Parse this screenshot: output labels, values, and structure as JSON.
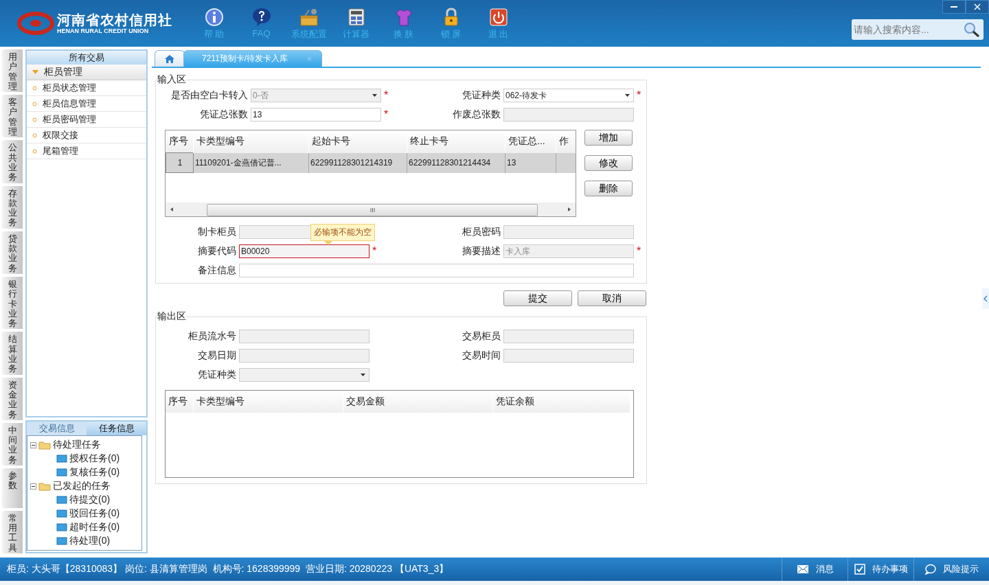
{
  "header": {
    "logo_title": "河南省农村信用社",
    "logo_subtitle": "HENAN RURAL CREDIT UNION",
    "toolbar": [
      {
        "kind": "help",
        "label": "帮 助"
      },
      {
        "kind": "faq",
        "label": "FAQ"
      },
      {
        "kind": "config",
        "label": "系统配置"
      },
      {
        "kind": "calculator",
        "label": "计算器"
      },
      {
        "kind": "skin",
        "label": "换 肤"
      },
      {
        "kind": "lock",
        "label": "锁 屏"
      },
      {
        "kind": "exit",
        "label": "退 出"
      }
    ],
    "search": {
      "placeholder": "请输入搜索内容..."
    }
  },
  "side_tabs": [
    {
      "label": "用户管理",
      "selected": false
    },
    {
      "label": "客户管理",
      "selected": false
    },
    {
      "label": "公共业务",
      "selected": false
    },
    {
      "label": "存款业务",
      "selected": false
    },
    {
      "label": "贷款业务",
      "selected": false
    },
    {
      "label": "银行卡业务",
      "selected": false
    },
    {
      "label": "结算业务",
      "selected": false
    },
    {
      "label": "资金业务",
      "selected": false
    },
    {
      "label": "中间业务",
      "selected": false
    },
    {
      "label": "参数",
      "selected": false
    },
    {
      "label": "常用工具",
      "selected": false
    }
  ],
  "nav": {
    "title": "所有交易",
    "groups": [
      {
        "label": "柜员管理",
        "expanded": true,
        "items": [
          "柜员状态管理",
          "柜员信息管理",
          "柜员密码管理",
          "权限交接",
          "尾箱管理"
        ]
      }
    ]
  },
  "task_panel": {
    "tabs": [
      {
        "label": "交易信息",
        "selected": false
      },
      {
        "label": "任务信息",
        "selected": true
      }
    ],
    "tree": [
      {
        "label": "待处理任务",
        "expanded": true,
        "children": [
          {
            "label": "授权任务(0)"
          },
          {
            "label": "复核任务(0)"
          }
        ]
      },
      {
        "label": "已发起的任务",
        "expanded": true,
        "children": [
          {
            "label": "待提交(0)"
          },
          {
            "label": "驳回任务(0)"
          },
          {
            "label": "超时任务(0)"
          },
          {
            "label": "待处理(0)"
          }
        ]
      }
    ]
  },
  "tabs": [
    {
      "kind": "home",
      "selected": false
    },
    {
      "kind": "page",
      "label": "7211预制卡/待发卡入库",
      "selected": true
    }
  ],
  "input_area": {
    "legend": "输入区",
    "fields": [
      {
        "label": "是否由空白卡转入",
        "kind": "select",
        "value": "0-否",
        "disabled": true,
        "invalid": false,
        "required_mark": "*"
      },
      {
        "label": "凭证种类",
        "kind": "select",
        "value": "062-待发卡",
        "disabled": false,
        "invalid": false,
        "required_mark": "*"
      },
      {
        "label": "凭证总张数",
        "kind": "text",
        "value": "13",
        "disabled": false,
        "invalid": false,
        "required_mark": "*"
      },
      {
        "label": "作废总张数",
        "kind": "text",
        "disabled": true,
        "invalid": false
      }
    ],
    "table": {
      "columns": [
        "序号",
        "卡类型编号",
        "起始卡号",
        "终止卡号",
        "凭证总...",
        "作"
      ],
      "rows": [
        {
          "cells": [
            "1",
            "11109201-金燕借记普...",
            "622991128301214319",
            "622991128301214434",
            "13"
          ],
          "selected": true
        }
      ]
    },
    "buttons": [
      "增加",
      "修改",
      "删除"
    ],
    "fields_2": [
      {
        "label": "制卡柜员",
        "kind": "text",
        "disabled": true,
        "invalid": false
      },
      {
        "label": "柜员密码",
        "kind": "text",
        "disabled": true,
        "invalid": false
      },
      {
        "label": "摘要代码",
        "kind": "text",
        "value": "B00020",
        "disabled": false,
        "invalid": true,
        "required_mark": "*"
      },
      {
        "label": "摘要描述",
        "kind": "text",
        "value": "卡入库",
        "disabled": true,
        "invalid": false,
        "required_mark": "*"
      },
      {
        "label": "备注信息",
        "kind": "wide",
        "disabled": false,
        "invalid": false
      }
    ],
    "tooltip": "必输项不能为空"
  },
  "actions": [
    "提交",
    "取消"
  ],
  "output_area": {
    "legend": "输出区",
    "fields": [
      {
        "label": "柜员流水号",
        "kind": "text",
        "disabled": true,
        "invalid": false
      },
      {
        "label": "交易柜员",
        "kind": "text",
        "disabled": true,
        "invalid": false
      },
      {
        "label": "交易日期",
        "kind": "text",
        "disabled": true,
        "invalid": false
      },
      {
        "label": "交易时间",
        "kind": "text",
        "disabled": true,
        "invalid": false
      },
      {
        "label": "凭证种类",
        "kind": "select",
        "disabled": true,
        "invalid": false
      }
    ],
    "table": {
      "columns": [
        "序号",
        "卡类型编号",
        "交易金额",
        "凭证余额"
      ]
    }
  },
  "status_bar": {
    "text": "柜员: 大头哥【28310083】 岗位: 县清算管理岗  机构号: 1628399999  营业日期: 20280223 【UAT3_3】",
    "items": [
      {
        "kind": "message",
        "label": "消息"
      },
      {
        "kind": "todo",
        "label": "待办事项"
      },
      {
        "kind": "risk",
        "label": "风险提示"
      }
    ]
  }
}
